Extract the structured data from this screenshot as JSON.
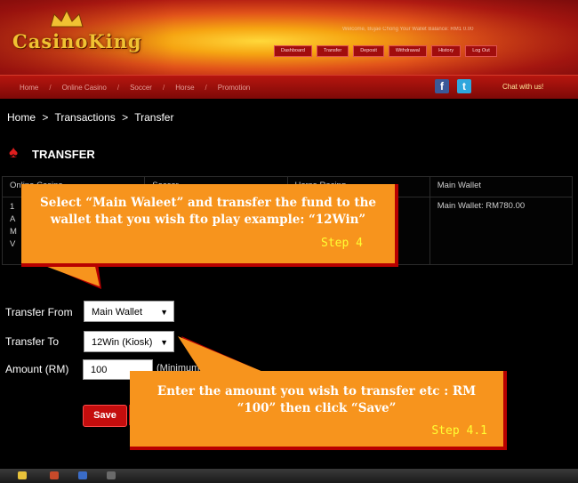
{
  "header": {
    "logo_text": "CasinoKing",
    "welcome_text": "Welcome, Bujae Chong    Your Wallet Balance: RM1 0.00",
    "top_buttons": [
      "Dashboard",
      "Transfer",
      "Deposit",
      "Withdrawal",
      "History",
      "Log Out"
    ],
    "nav_items": [
      "Home",
      "Online Casino",
      "Soccer",
      "Horse",
      "Promotion"
    ],
    "social": {
      "facebook": "f",
      "twitter": "t"
    },
    "chat_label": "Chat with us!"
  },
  "breadcrumb": [
    "Home",
    ">",
    "Transactions",
    ">",
    "Transfer"
  ],
  "page_title": "TRANSFER",
  "wallet_table": {
    "headers": [
      "Online Casino",
      "Soccer",
      "Horse Racing",
      "Main Wallet"
    ],
    "row_fragments": [
      "1",
      "A",
      "M",
      "V"
    ],
    "main_wallet_cell": "Main Wallet: RM780.00"
  },
  "form": {
    "transfer_from_label": "Transfer From",
    "transfer_from_value": "Main Wallet",
    "transfer_to_label": "Transfer To",
    "transfer_to_value": "12Win (Kiosk)",
    "amount_label": "Amount (RM)",
    "amount_value": "100",
    "min_note": "(Minimum RM10.00)",
    "save_label": "Save"
  },
  "callouts": {
    "step4": {
      "text": "Select “Main Waleet” and transfer the fund to the wallet that you wish fto play example: “12Win”",
      "step": "Step 4"
    },
    "step41": {
      "text": "Enter the amount you wish to transfer etc : RM “100” then click “Save”",
      "step": "Step 4.1"
    }
  },
  "colors": {
    "callout_bg": "#f7941d",
    "callout_border": "#b80000",
    "step_text": "#ffff33",
    "accent_red": "#c40d0d"
  }
}
